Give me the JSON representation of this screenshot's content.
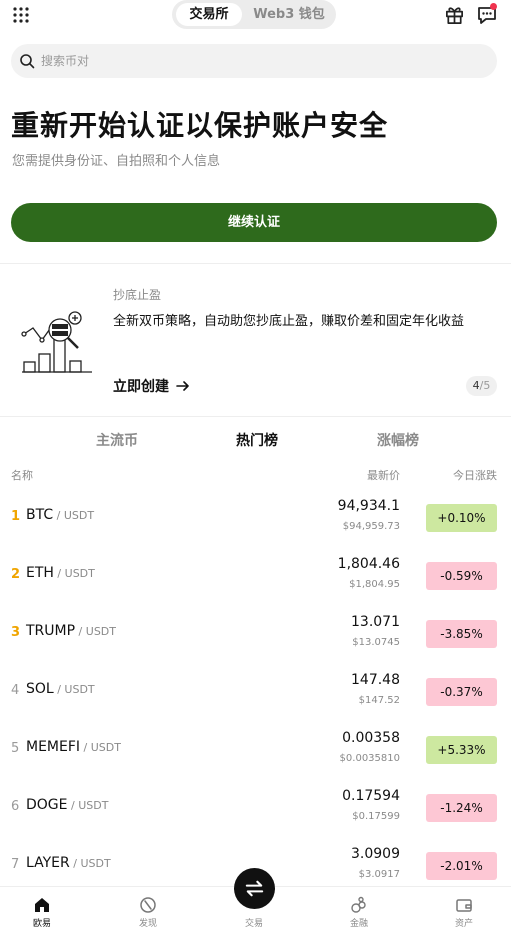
{
  "header": {
    "segments": [
      {
        "label": "交易所",
        "active": true
      },
      {
        "label": "Web3 钱包",
        "active": false
      }
    ],
    "icons": [
      "grid-menu-icon",
      "gift-icon",
      "chat-icon"
    ],
    "notification_dot_color": "#f0334f"
  },
  "search": {
    "placeholder": "搜索币对"
  },
  "verification": {
    "title": "重新开始认证以保护账户安全",
    "subtitle": "您需提供身份证、自拍照和个人信息",
    "button": "继续认证",
    "button_color": "#2e6a1c"
  },
  "promo": {
    "tag": "抄底止盈",
    "text": "全新双币策略，自动助您抄底止盈，赚取价差和固定年化收益",
    "cta": "立即创建",
    "page_current": "4",
    "page_total": "/5"
  },
  "market": {
    "tabs": [
      {
        "label": "主流币",
        "active": false
      },
      {
        "label": "热门榜",
        "active": true
      },
      {
        "label": "涨幅榜",
        "active": false
      }
    ],
    "columns": {
      "name": "名称",
      "price": "最新价",
      "change": "今日涨跌"
    },
    "rows": [
      {
        "rank": "1",
        "base": "BTC",
        "quote": " / USDT",
        "price": "94,934.1",
        "fiat": "$94,959.73",
        "change": "+0.10%",
        "direction": "up"
      },
      {
        "rank": "2",
        "base": "ETH",
        "quote": " / USDT",
        "price": "1,804.46",
        "fiat": "$1,804.95",
        "change": "-0.59%",
        "direction": "down"
      },
      {
        "rank": "3",
        "base": "TRUMP",
        "quote": " / USDT",
        "price": "13.071",
        "fiat": "$13.0745",
        "change": "-3.85%",
        "direction": "down"
      },
      {
        "rank": "4",
        "base": "SOL",
        "quote": " / USDT",
        "price": "147.48",
        "fiat": "$147.52",
        "change": "-0.37%",
        "direction": "down"
      },
      {
        "rank": "5",
        "base": "MEMEFI",
        "quote": " / USDT",
        "price": "0.00358",
        "fiat": "$0.0035810",
        "change": "+5.33%",
        "direction": "up"
      },
      {
        "rank": "6",
        "base": "DOGE",
        "quote": " / USDT",
        "price": "0.17594",
        "fiat": "$0.17599",
        "change": "-1.24%",
        "direction": "down"
      },
      {
        "rank": "7",
        "base": "LAYER",
        "quote": " / USDT",
        "price": "3.0909",
        "fiat": "$3.0917",
        "change": "-2.01%",
        "direction": "down"
      }
    ],
    "up_color": "#cde8a0",
    "down_color": "#fdc7d4",
    "top_rank_color": "#f0a500"
  },
  "bottom_nav": [
    {
      "label": "欧易",
      "icon": "home-icon",
      "active": true
    },
    {
      "label": "发现",
      "icon": "discover-icon",
      "active": false
    },
    {
      "label": "交易",
      "icon": "trade-swap-icon",
      "active": false
    },
    {
      "label": "金融",
      "icon": "finance-icon",
      "active": false
    },
    {
      "label": "资产",
      "icon": "wallet-icon",
      "active": false
    }
  ]
}
